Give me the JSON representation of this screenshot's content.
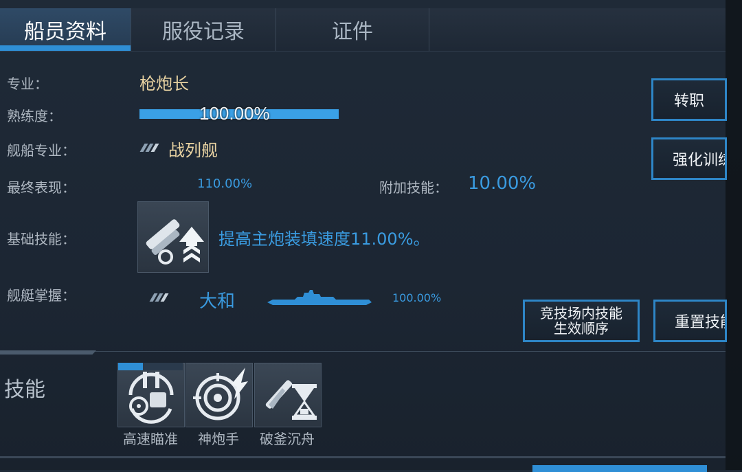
{
  "tabs": [
    {
      "label": "船员资料"
    },
    {
      "label": "服役记录"
    },
    {
      "label": "证件"
    }
  ],
  "profile": {
    "specialty_label": "专业：",
    "specialty_value": "枪炮长",
    "proficiency_label": "熟练度：",
    "proficiency_value": "100.00%",
    "proficiency_fill": 1.0,
    "ship_specialty_label": "舰船专业：",
    "ship_specialty_value": "战列舰",
    "final_perf_label": "最终表现：",
    "final_perf_value": "110.00%",
    "extra_skill_label": "附加技能：",
    "extra_skill_value": "10.00%",
    "base_skill_label": "基础技能：",
    "base_skill_desc": "提高主炮装填速度11.00%。",
    "mastery_label": "舰艇掌握：",
    "mastery_ship": "大和",
    "mastery_value": "100.00%"
  },
  "buttons": {
    "transfer": "转职",
    "training": "强化训练",
    "arena_order": "竞技场内技能生效顺序",
    "reset": "重置技能"
  },
  "skills": {
    "section_label": "技能",
    "items": [
      {
        "name": "高速瞄准",
        "icon": "rapid-aim-icon"
      },
      {
        "name": "神炮手",
        "icon": "sharpshooter-icon"
      },
      {
        "name": "破釜沉舟",
        "icon": "last-stand-icon"
      }
    ]
  },
  "colors": {
    "accent": "#2f8fd6",
    "gold": "#e9d3a2",
    "blue_text": "#3a9be0"
  }
}
